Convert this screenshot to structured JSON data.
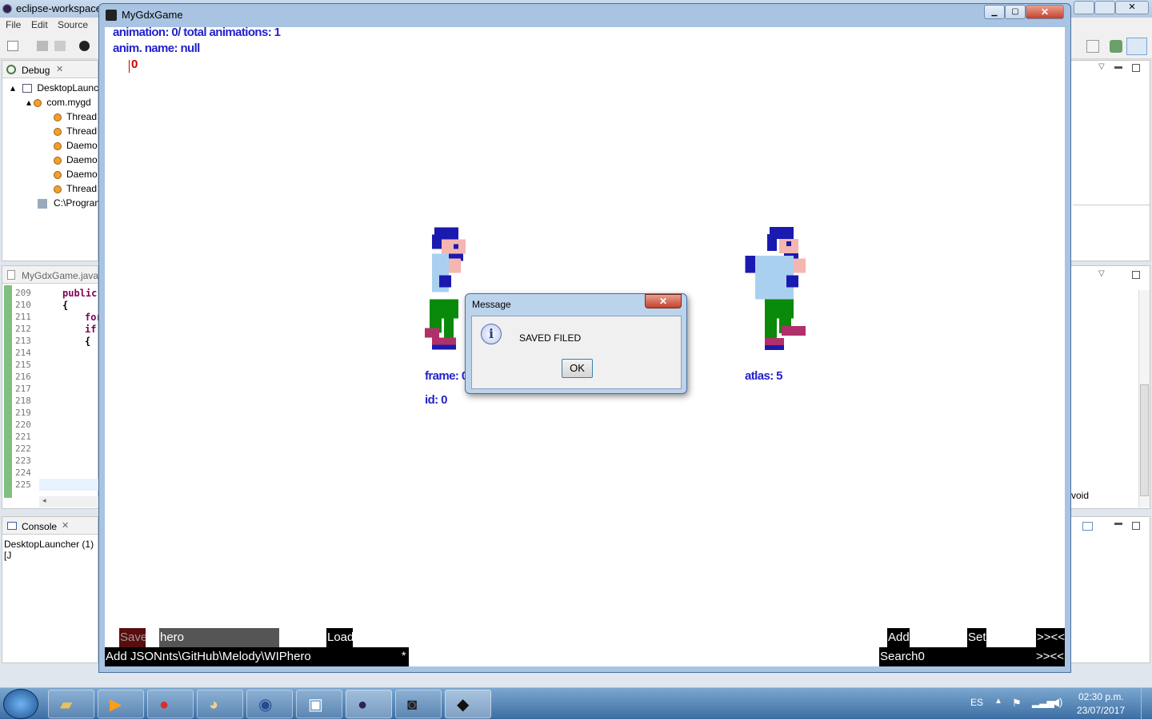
{
  "eclipse": {
    "title": "eclipse-workspace",
    "menu": [
      "File",
      "Edit",
      "Source"
    ],
    "debug_tab": "Debug",
    "tree": [
      "DesktopLaunc",
      "com.mygd",
      "Thread",
      "Thread",
      "Daemo",
      "Daemo",
      "Daemo",
      "Thread",
      "C:\\Progran"
    ],
    "editor_tab": "MyGdxGame.java",
    "line_numbers": [
      "209",
      "210",
      "211",
      "212",
      "213",
      "214",
      "215",
      "216",
      "217",
      "218",
      "219",
      "220",
      "221",
      "222",
      "223",
      "224",
      "225"
    ],
    "code": [
      "public",
      "{",
      "for",
      "if",
      "{"
    ],
    "console_tab": "Console",
    "console_line": "DesktopLauncher (1) [J",
    "right_void": "void"
  },
  "game": {
    "title": "MyGdxGame",
    "animation_info": "animation: 0/ total animations: 1",
    "anim_name": "anim. name: null",
    "cursor_value": "0",
    "frame_label": "frame: 0",
    "id_label": "id: 0",
    "atlas_label": "atlas: 5",
    "save_btn": "Save",
    "name_input": "hero",
    "load_btn": "Load",
    "add_json": "Add JSONnts\\GitHub\\Melody\\WIPhero",
    "asterisk": "*",
    "add_btn": "Add",
    "set_btn": "Set",
    "nav_top": ">><<",
    "search": "Search0",
    "nav_bottom": ">><<"
  },
  "dialog": {
    "title": "Message",
    "message": "SAVED FILED",
    "ok": "OK",
    "close_glyph": "✕",
    "info_glyph": "i"
  },
  "taskbar": {
    "lang": "ES",
    "time": "02:30 p.m.",
    "date": "23/07/2017"
  },
  "colors": {
    "game_text": "#2222cc",
    "cursor": "#cc0000",
    "sprite_hair": "#1a1ab0",
    "sprite_shirt": "#aad0f0",
    "sprite_pants": "#0a8a0a",
    "sprite_shoes": "#b0306a",
    "sprite_skin": "#f4b6b0"
  }
}
